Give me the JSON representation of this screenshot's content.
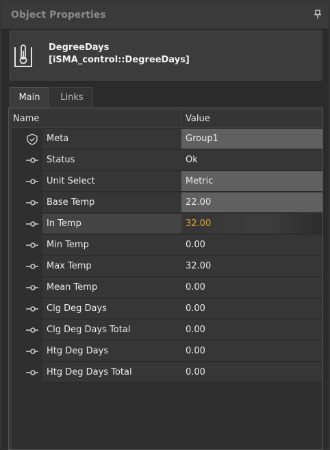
{
  "panel": {
    "title": "Object Properties",
    "pin_icon": "pin-icon"
  },
  "object": {
    "icon": "thermometer-icon",
    "name": "DegreeDays",
    "type": "[iSMA_control::DegreeDays]"
  },
  "tabs": [
    {
      "label": "Main",
      "active": true
    },
    {
      "label": "Links",
      "active": false
    }
  ],
  "table": {
    "columns": {
      "name": "Name",
      "value": "Value"
    },
    "rows": [
      {
        "name": "Meta",
        "value": "Group1",
        "icon": "shield-check-icon"
      },
      {
        "name": "Status",
        "value": "Ok",
        "icon": "slot-connector-icon"
      },
      {
        "name": "Unit Select",
        "value": "Metric",
        "icon": "slot-connector-icon"
      },
      {
        "name": "Base Temp",
        "value": "22.00",
        "icon": "slot-connector-icon"
      },
      {
        "name": "In Temp",
        "value": "32.00",
        "icon": "slot-connector-icon"
      },
      {
        "name": "Min Temp",
        "value": "0.00",
        "icon": "slot-connector-icon"
      },
      {
        "name": "Max Temp",
        "value": "32.00",
        "icon": "slot-connector-icon"
      },
      {
        "name": "Mean Temp",
        "value": "0.00",
        "icon": "slot-connector-icon"
      },
      {
        "name": "Clg Deg Days",
        "value": "0.00",
        "icon": "slot-connector-icon"
      },
      {
        "name": "Clg Deg Days Total",
        "value": "0.00",
        "icon": "slot-connector-icon"
      },
      {
        "name": "Htg Deg Days",
        "value": "0.00",
        "icon": "slot-connector-icon"
      },
      {
        "name": "Htg Deg Days Total",
        "value": "0.00",
        "icon": "slot-connector-icon"
      }
    ]
  },
  "colors": {
    "highlight_value": "#e0a432",
    "background": "#2b2b2b"
  }
}
